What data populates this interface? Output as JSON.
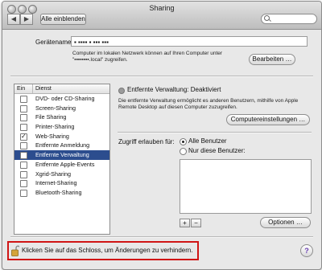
{
  "window": {
    "title": "Sharing"
  },
  "toolbar": {
    "back_glyph": "◀",
    "forward_glyph": "▶",
    "show_all_label": "Alle einblenden",
    "search_placeholder": ""
  },
  "host": {
    "label": "Gerätename:",
    "value": "▪ ▪▪▪▪ ▪ ▪▪▪ ▪▪▪",
    "info": "Computer im lokalen Netzwerk können auf Ihren Computer unter \"▪▪▪▪▪▪▪▪.local\" zugreifen.",
    "edit_label": "Bearbeiten …"
  },
  "services": {
    "header_on": "Ein",
    "header_service": "Dienst",
    "items": [
      {
        "label": "DVD- oder CD-Sharing",
        "checked": false,
        "selected": false
      },
      {
        "label": "Screen-Sharing",
        "checked": false,
        "selected": false
      },
      {
        "label": "File Sharing",
        "checked": false,
        "selected": false
      },
      {
        "label": "Printer-Sharing",
        "checked": false,
        "selected": false
      },
      {
        "label": "Web-Sharing",
        "checked": true,
        "selected": false
      },
      {
        "label": "Entfernte Anmeldung",
        "checked": false,
        "selected": false
      },
      {
        "label": "Entfernte Verwaltung",
        "checked": false,
        "selected": true
      },
      {
        "label": "Entfernte Apple-Events",
        "checked": false,
        "selected": false
      },
      {
        "label": "Xgrid-Sharing",
        "checked": false,
        "selected": false
      },
      {
        "label": "Internet-Sharing",
        "checked": false,
        "selected": false
      },
      {
        "label": "Bluetooth-Sharing",
        "checked": false,
        "selected": false
      }
    ]
  },
  "detail": {
    "status": "Entfernte Verwaltung: Deaktiviert",
    "description": "Die entfernte Verwaltung ermöglicht es anderen Benutzern, mithilfe von Apple Remote Desktop auf diesen Computer zuzugreifen.",
    "computer_settings_label": "Computereinstellungen …",
    "access_label": "Zugriff erlauben für:",
    "radio_all": "Alle Benutzer",
    "radio_only": "Nur diese Benutzer:",
    "add_glyph": "+",
    "remove_glyph": "−",
    "options_label": "Optionen …"
  },
  "footer": {
    "lock_text": "Klicken Sie auf das Schloss, um Änderungen zu verhindern.",
    "help_glyph": "?"
  },
  "colors": {
    "selection": "#2c4d8e",
    "highlight_border": "#d01515"
  }
}
